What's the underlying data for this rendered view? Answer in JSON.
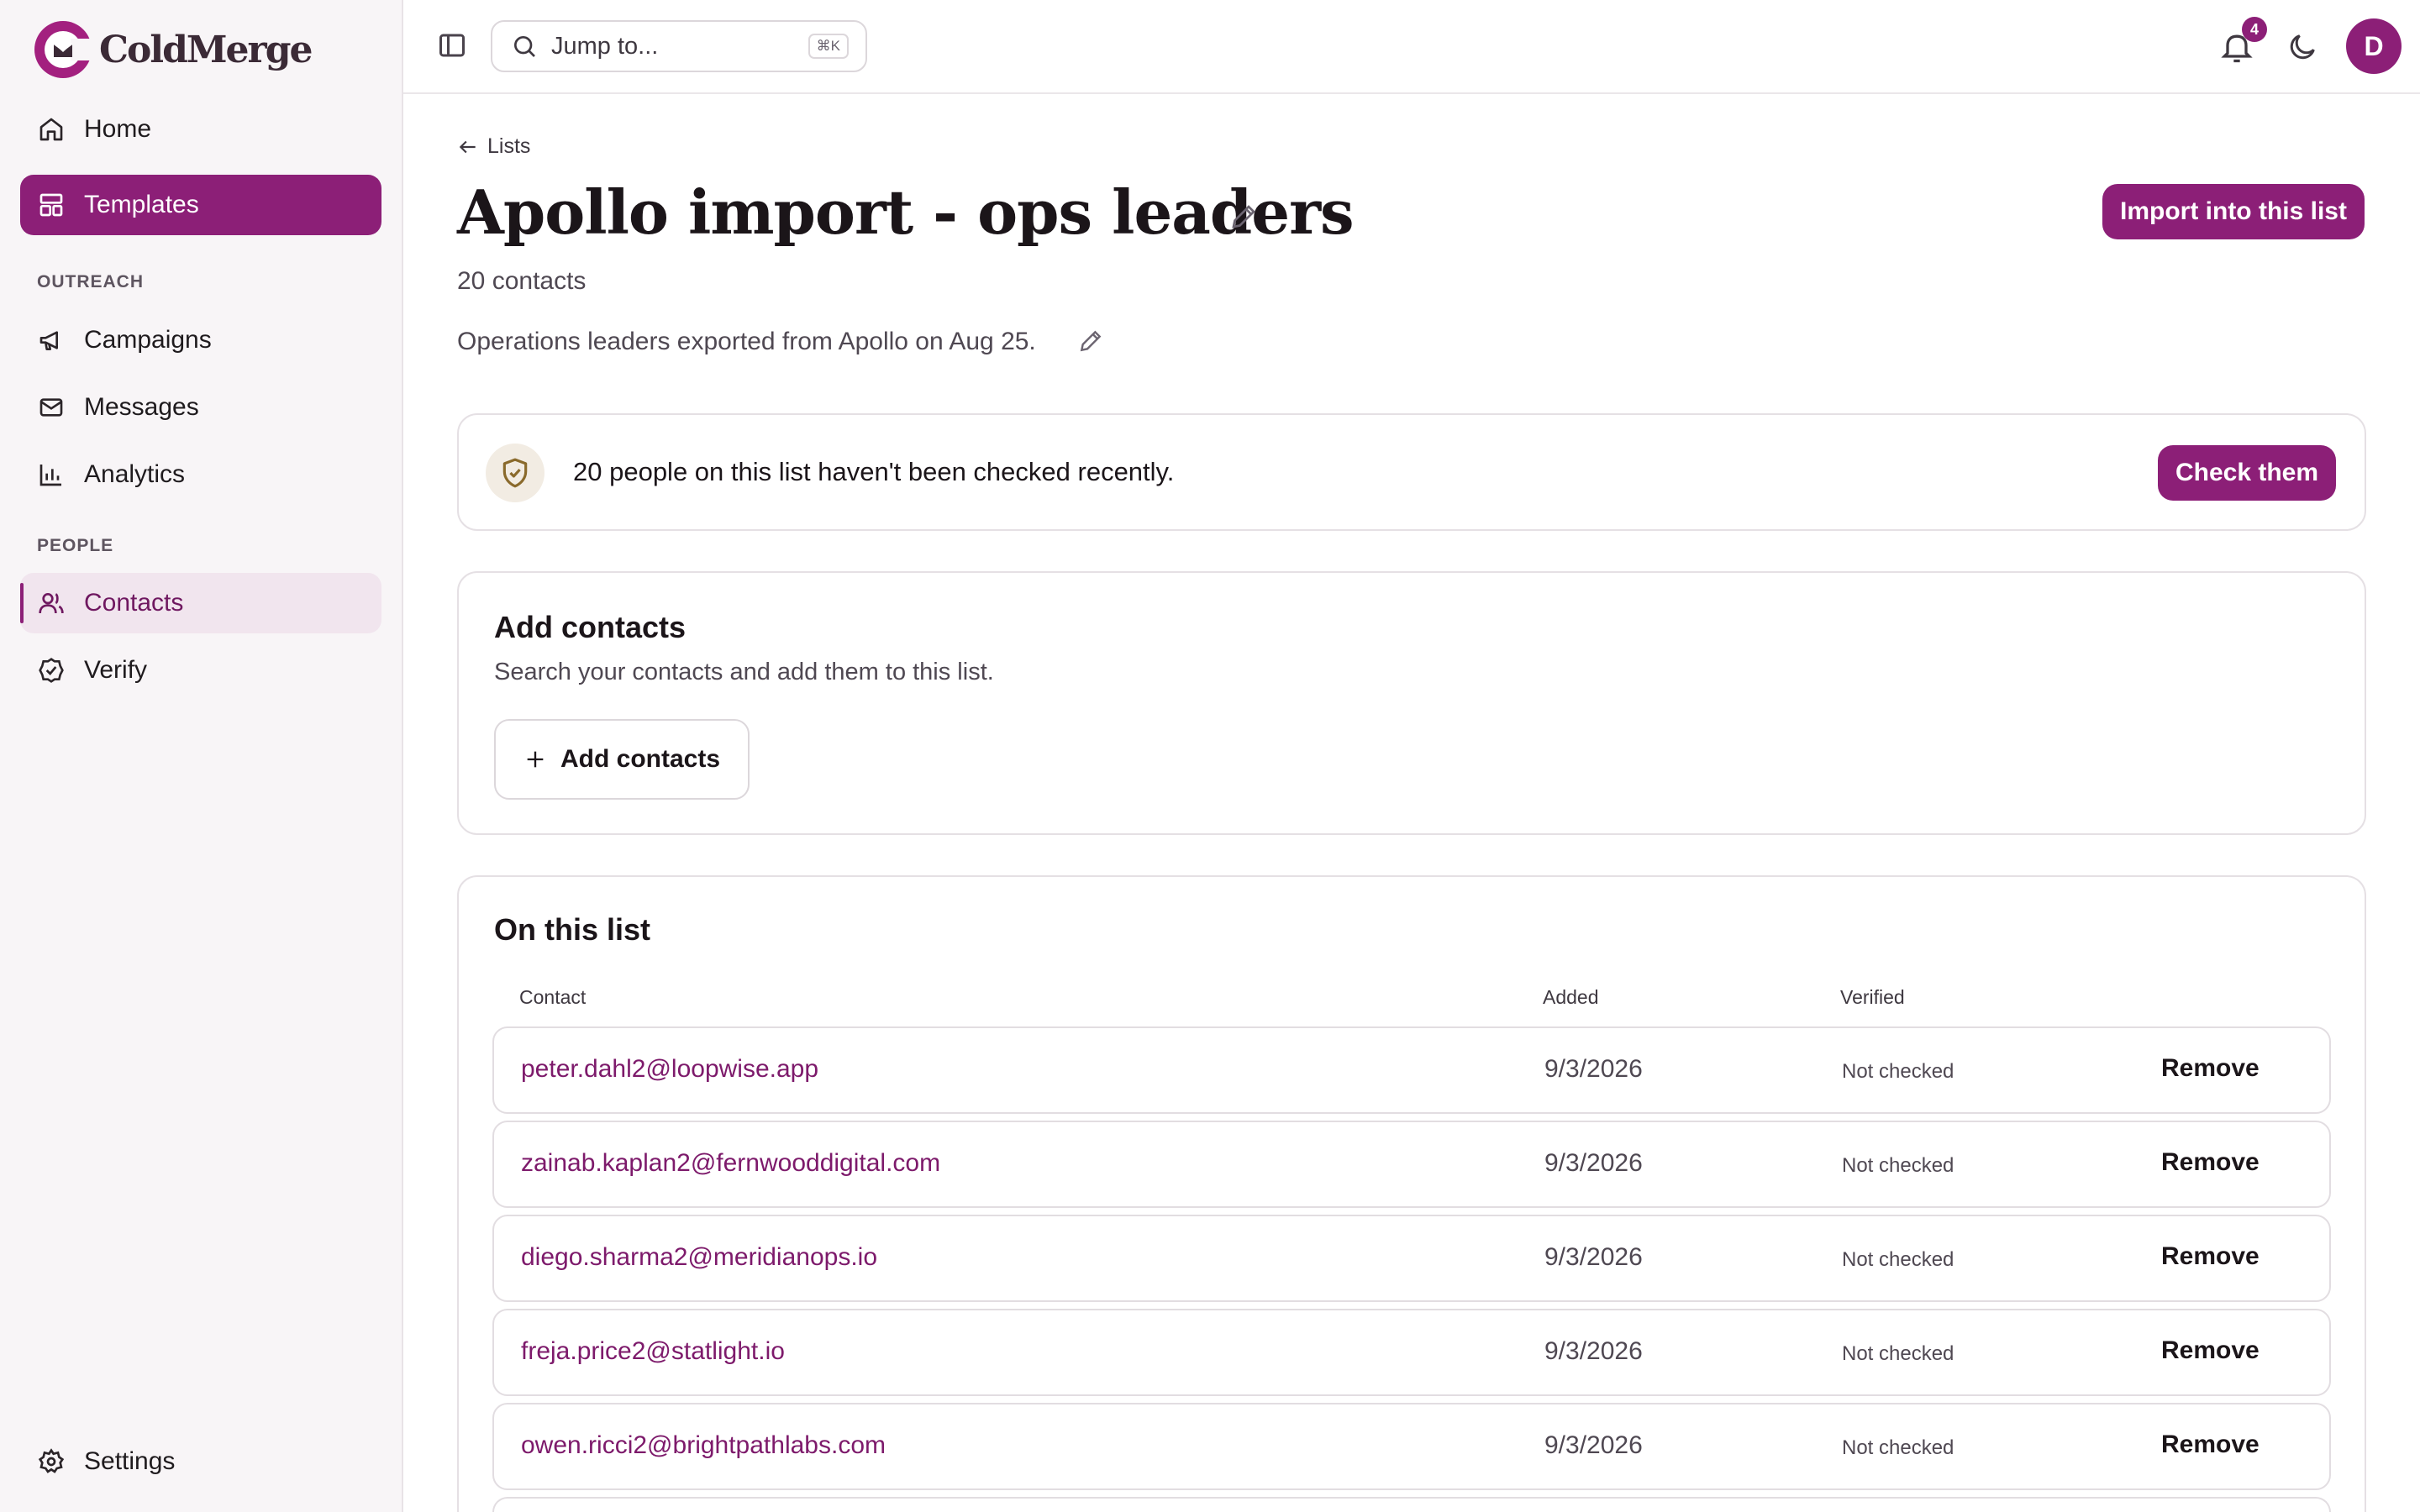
{
  "app": {
    "name": "ColdMerge",
    "accent": "#8c1f77"
  },
  "sidebar": {
    "items": [
      {
        "label": "Home",
        "icon": "home-icon"
      },
      {
        "label": "Templates",
        "icon": "layout-icon"
      },
      {
        "label": "Campaigns",
        "icon": "megaphone-icon"
      },
      {
        "label": "Messages",
        "icon": "mail-icon"
      },
      {
        "label": "Analytics",
        "icon": "bar-chart-icon"
      },
      {
        "label": "Contacts",
        "icon": "users-icon"
      },
      {
        "label": "Verify",
        "icon": "check-circle-icon"
      }
    ],
    "sections": {
      "outreach": "OUTREACH",
      "people": "PEOPLE"
    },
    "settings": {
      "label": "Settings",
      "icon": "gear-icon"
    }
  },
  "topbar": {
    "search_placeholder": "Jump to...",
    "shortcut": "⌘K",
    "notifications_count": "4",
    "avatar_initial": "D"
  },
  "page": {
    "back_label": "Lists",
    "title": "Apollo import - ops leaders",
    "count": "20 contacts",
    "description": "Operations leaders exported from Apollo on Aug 25.",
    "import_button": "Import into this list"
  },
  "notice": {
    "text": "20 people on this list haven't been checked recently.",
    "button": "Check them"
  },
  "add_contacts": {
    "title": "Add contacts",
    "subtitle": "Search your contacts and add them to this list.",
    "button": "Add contacts"
  },
  "list": {
    "title": "On this list",
    "columns": {
      "contact": "Contact",
      "added": "Added",
      "verified": "Verified"
    },
    "rows": [
      {
        "email": "peter.dahl2@loopwise.app",
        "added": "9/3/2026",
        "verified": "Not checked",
        "action": "Remove"
      },
      {
        "email": "zainab.kaplan2@fernwooddigital.com",
        "added": "9/3/2026",
        "verified": "Not checked",
        "action": "Remove"
      },
      {
        "email": "diego.sharma2@meridianops.io",
        "added": "9/3/2026",
        "verified": "Not checked",
        "action": "Remove"
      },
      {
        "email": "freja.price2@statlight.io",
        "added": "9/3/2026",
        "verified": "Not checked",
        "action": "Remove"
      },
      {
        "email": "owen.ricci2@brightpathlabs.com",
        "added": "9/3/2026",
        "verified": "Not checked",
        "action": "Remove"
      }
    ]
  }
}
